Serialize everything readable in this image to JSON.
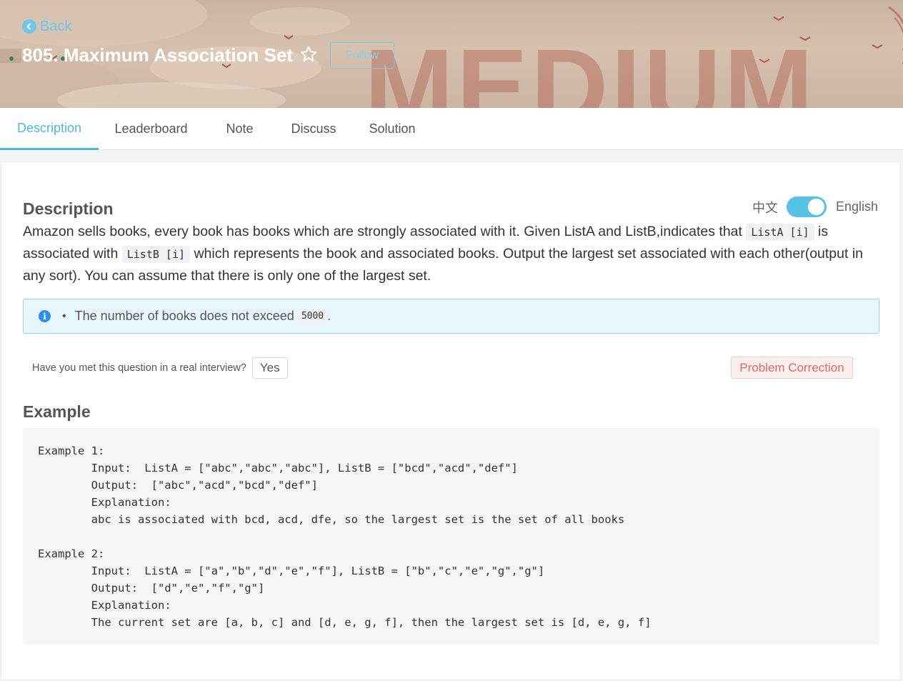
{
  "header": {
    "back_label": "Back",
    "title": "805. Maximum Association Set",
    "follow_label": "Follow",
    "difficulty_watermark": "MEDIUM",
    "accent_color": "#4fb8df"
  },
  "tabs": [
    {
      "label": "Description",
      "active": true
    },
    {
      "label": "Leaderboard",
      "active": false
    },
    {
      "label": "Note",
      "active": false
    },
    {
      "label": "Discuss",
      "active": false
    },
    {
      "label": "Solution",
      "active": false
    }
  ],
  "description": {
    "heading": "Description",
    "lang_chinese": "中文",
    "lang_english": "English",
    "text_1": "Amazon sells books, every book has books which are strongly associated with it. Given ListA and ListB,indicates that ",
    "code_1": "ListA [i]",
    "text_2": " is associated with ",
    "code_2": "ListB [i]",
    "text_3": " which represents the book and associated books. Output the largest set associated with each other(output in any sort). You can assume that there is only one of the largest set."
  },
  "notice": {
    "text": "The number of books does not exceed",
    "code": "5000",
    "suffix": "."
  },
  "interview": {
    "question": "Have you met this question in a real interview?",
    "yes_label": "Yes",
    "correction_label": "Problem Correction"
  },
  "example": {
    "heading": "Example",
    "content": "Example 1:\n\tInput:  ListA = [\"abc\",\"abc\",\"abc\"], ListB = [\"bcd\",\"acd\",\"def\"]\n\tOutput:  [\"abc\",\"acd\",\"bcd\",\"def\"]\n\tExplanation:\n\tabc is associated with bcd, acd, dfe, so the largest set is the set of all books\n\nExample 2:\n\tInput:  ListA = [\"a\",\"b\",\"d\",\"e\",\"f\"], ListB = [\"b\",\"c\",\"e\",\"g\",\"g\"]\n\tOutput:  [\"d\",\"e\",\"f\",\"g\"]\n\tExplanation:\n\tThe current set are [a, b, c] and [d, e, g, f], then the largest set is [d, e, g, f]"
  }
}
